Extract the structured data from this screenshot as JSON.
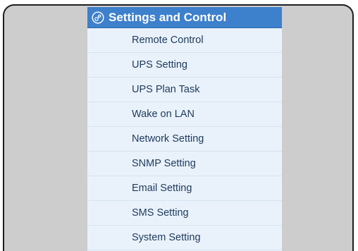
{
  "menu": {
    "header": {
      "title": "Settings and Control",
      "icon": "settings-circle-icon"
    },
    "items": [
      {
        "label": "Remote Control"
      },
      {
        "label": "UPS Setting"
      },
      {
        "label": "UPS Plan Task"
      },
      {
        "label": "Wake on LAN"
      },
      {
        "label": "Network Setting"
      },
      {
        "label": "SNMP Setting"
      },
      {
        "label": "Email Setting"
      },
      {
        "label": "SMS Setting"
      },
      {
        "label": "System Setting"
      }
    ]
  },
  "colors": {
    "header_bg": "#3d80cc",
    "menu_bg": "#e9f2fb",
    "frame_bg": "#cdcdcd",
    "item_text": "#1e3a5c"
  }
}
